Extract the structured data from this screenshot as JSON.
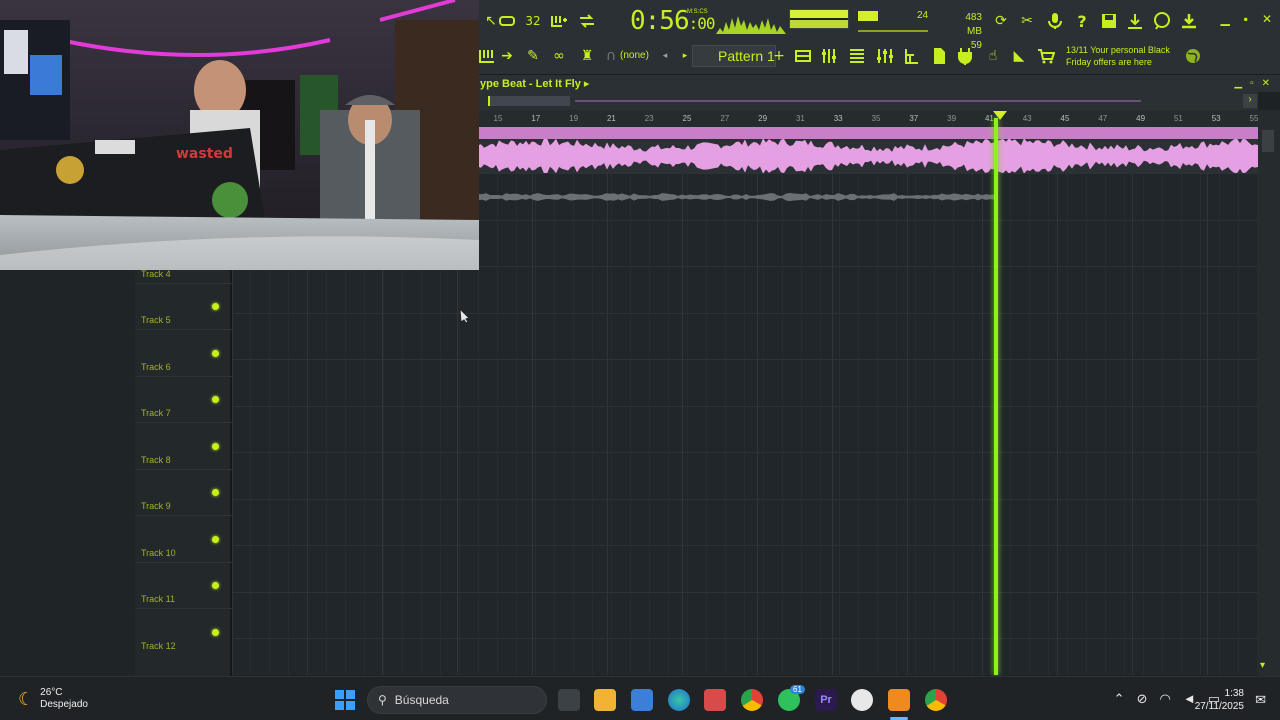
{
  "toolbar": {
    "time_main": "0:56",
    "time_frac": ":00",
    "time_unit": "M:S:CS",
    "cpu": "24",
    "mem_mb": "483 MB",
    "mem_poly": "59",
    "pattern_label": "Pattern 1",
    "none_label": "(none)",
    "promo_line1": "13/11  Your personal Black",
    "promo_line2": "Friday offers are here",
    "icons": [
      "tempo-icon",
      "metronome-icon",
      "record-icon",
      "wait-icon",
      "countdown-icon",
      "loop-icon",
      "playlist-icon",
      "piano-roll-icon",
      "channel-rack-icon",
      "mixer-icon",
      "browser-icon",
      "plugin-icon",
      "help-icon",
      "save-icon",
      "export-icon",
      "chat-icon",
      "download-icon"
    ]
  },
  "playlist": {
    "title": "ype Beat - Let It Fly ▸",
    "ruler_ticks": [
      "15",
      "17",
      "19",
      "21",
      "23",
      "25",
      "27",
      "29",
      "31",
      "33",
      "35",
      "37",
      "39",
      "41",
      "43",
      "45",
      "47",
      "49",
      "51",
      "53",
      "55"
    ],
    "tracks": [
      {
        "name": "Track 4"
      },
      {
        "name": "Track 5"
      },
      {
        "name": "Track 6"
      },
      {
        "name": "Track 7"
      },
      {
        "name": "Track 8"
      },
      {
        "name": "Track 9"
      },
      {
        "name": "Track 10"
      },
      {
        "name": "Track 11"
      },
      {
        "name": "Track 12"
      }
    ]
  },
  "taskbar": {
    "temperature": "26°C",
    "weather": "Despejado",
    "search_placeholder": "Búsqueda",
    "time": "1:38",
    "date": "27/11/2025",
    "whatsapp_badge": "61"
  },
  "colors": {
    "accent": "#c7ef1f",
    "clip": "#e5a0e3",
    "playhead": "#8ef01c"
  }
}
